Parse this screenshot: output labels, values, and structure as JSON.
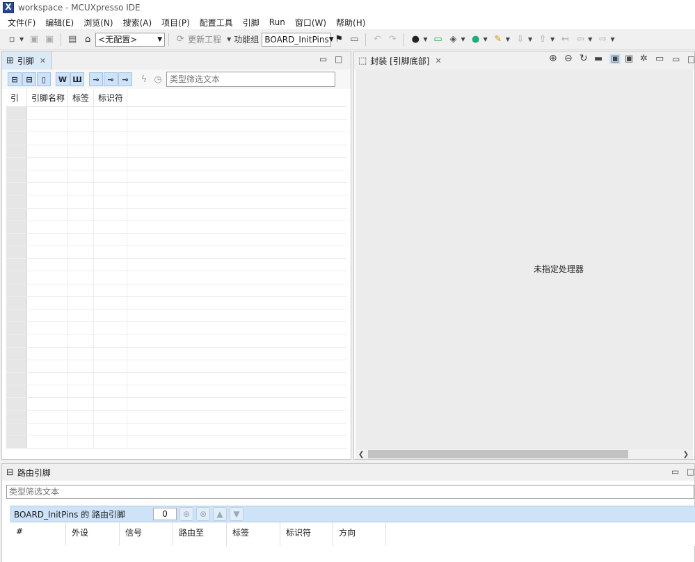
{
  "window": {
    "title": "workspace - MCUXpresso IDE",
    "app_icon_glyph": "X"
  },
  "menu": [
    "文件(F)",
    "编辑(E)",
    "浏览(N)",
    "搜索(A)",
    "项目(P)",
    "配置工具",
    "引脚",
    "Run",
    "窗口(W)",
    "帮助(H)"
  ],
  "toolbar": {
    "config_select": "<无配置>",
    "update_project": "更新工程",
    "function_group_label": "功能组",
    "function_group_value": "BOARD_InitPins"
  },
  "pins_panel": {
    "tab_label": "引脚",
    "filter_placeholder": "类型筛选文本",
    "columns": [
      "引",
      "引脚名称",
      "标签",
      "标识符"
    ]
  },
  "package_panel": {
    "tab_label": "封装 [引脚底部]",
    "message": "未指定处理器"
  },
  "routed_panel": {
    "tab_label": "路由引脚",
    "filter_placeholder": "类型筛选文本",
    "header_title": "BOARD_InitPins 的 路由引脚",
    "count": "0",
    "columns": [
      "#",
      "外设",
      "信号",
      "路由至",
      "标签",
      "标识符",
      "方向"
    ]
  }
}
